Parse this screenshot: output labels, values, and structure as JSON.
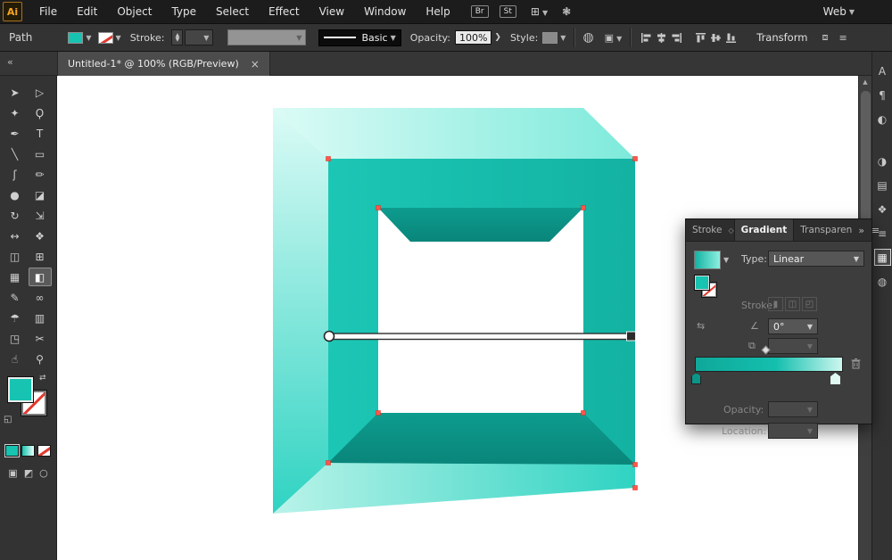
{
  "app": {
    "logo_text": "Ai",
    "workspace_label": "Web"
  },
  "menu_bar": {
    "items": [
      "File",
      "Edit",
      "Object",
      "Type",
      "Select",
      "Effect",
      "View",
      "Window",
      "Help"
    ],
    "bridge_button": "Br",
    "stock_button": "St"
  },
  "control_bar": {
    "selection_type": "Path",
    "stroke_label": "Stroke:",
    "profile_name": "Basic",
    "opacity_label": "Opacity:",
    "opacity_value": "100%",
    "style_label": "Style:",
    "transform_label": "Transform"
  },
  "document_tab": {
    "title": "Untitled-1* @ 100% (RGB/Preview)",
    "close_glyph": "×"
  },
  "toolbar": {
    "collapse_glyph": "«"
  },
  "gradient_panel": {
    "tabs": {
      "stroke": "Stroke",
      "gradient": "Gradient",
      "transparency": "Transparen"
    },
    "type_label": "Type:",
    "type_value": "Linear",
    "stroke_label": "Stroke:",
    "angle_value": "0°",
    "opacity_label": "Opacity:",
    "location_label": "Location:",
    "slider": {
      "start_color": "#0d9488",
      "end_color": "#dff8f2"
    }
  },
  "artwork": {
    "description": "3D square frame filled with teal linear gradient, selected, with gradient annotator bar",
    "gradient_type": "Linear",
    "gradient_angle": "0°"
  },
  "colors": {
    "accent_teal": "#17c3b1",
    "teal_dark": "#0d9488",
    "teal_light": "#dcfbf6",
    "anchor_red": "#ff564c",
    "none_red": "#e23a2f",
    "panel_bg": "#3d3d3d",
    "ui_bg": "#333333"
  }
}
